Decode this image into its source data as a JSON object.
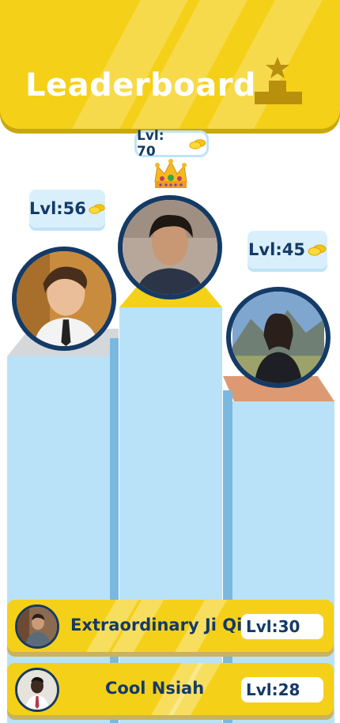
{
  "header": {
    "title": "Leaderboard",
    "icon": "podium-icon"
  },
  "podium": [
    {
      "rank": 1,
      "level_label": "Lvl: 70",
      "badge": "crown-icon",
      "cap_color": "#F5D019"
    },
    {
      "rank": 2,
      "level_label": "Lvl:56",
      "cap_color": "#D4D8DA"
    },
    {
      "rank": 3,
      "level_label": "Lvl:45",
      "cap_color": "#DD9A72"
    }
  ],
  "list": [
    {
      "name": "Extraordinary Ji Qi",
      "level_label": "Lvl:30"
    },
    {
      "name": "Cool Nsiah",
      "level_label": "Lvl:28"
    }
  ],
  "colors": {
    "header_yellow": "#F5D019",
    "navy": "#143A66",
    "column_blue": "#B9E2F9",
    "column_side": "#7AB8DF"
  }
}
